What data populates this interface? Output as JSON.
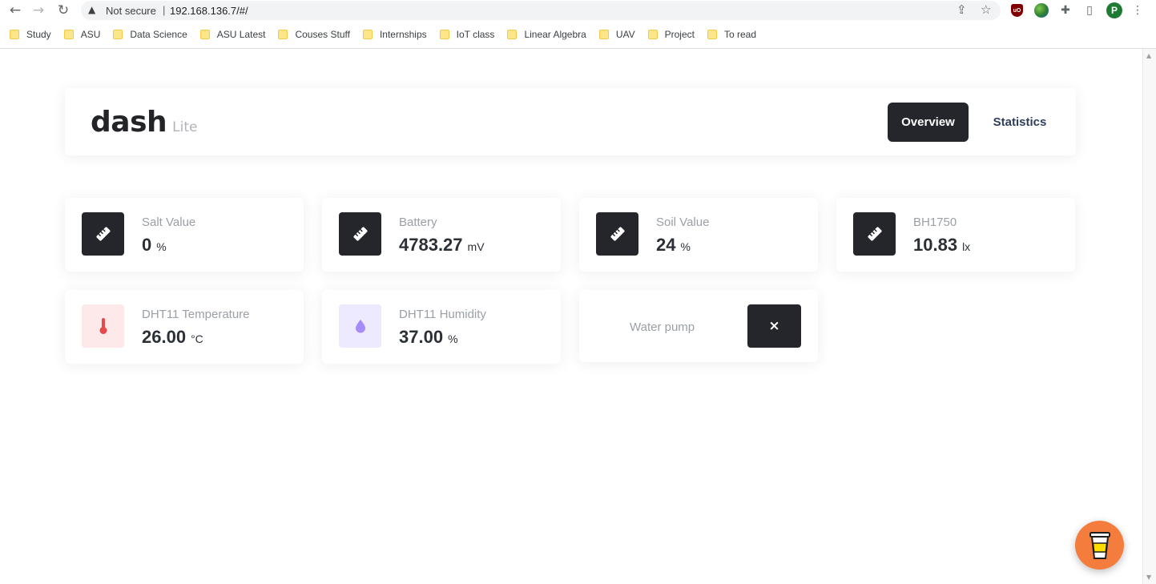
{
  "browser": {
    "security_icon": "warning-triangle-icon",
    "security_text": "Not secure",
    "separator": "|",
    "url": "192.168.136.7/#/",
    "avatar_letter": "P",
    "ublock_text": "uO",
    "bookmarks": [
      {
        "label": "Study"
      },
      {
        "label": "ASU"
      },
      {
        "label": "Data Science"
      },
      {
        "label": "ASU Latest"
      },
      {
        "label": "Couses Stuff"
      },
      {
        "label": "Internships"
      },
      {
        "label": "IoT class"
      },
      {
        "label": "Linear Algebra"
      },
      {
        "label": "UAV"
      },
      {
        "label": "Project"
      },
      {
        "label": "To read"
      }
    ]
  },
  "header": {
    "brand": "dash",
    "brand_sub": "Lite",
    "tabs": [
      {
        "label": "Overview",
        "active": true
      },
      {
        "label": "Statistics",
        "active": false
      }
    ]
  },
  "cards": [
    {
      "title": "Salt Value",
      "value": "0",
      "unit": "%",
      "icon": "ruler-icon"
    },
    {
      "title": "Battery",
      "value": "4783.27",
      "unit": "mV",
      "icon": "ruler-icon"
    },
    {
      "title": "Soil Value",
      "value": "24",
      "unit": "%",
      "icon": "ruler-icon"
    },
    {
      "title": "BH1750",
      "value": "10.83",
      "unit": "lx",
      "icon": "ruler-icon"
    },
    {
      "title": "DHT11 Temperature",
      "value": "26.00",
      "unit": "°C",
      "icon": "thermometer-icon"
    },
    {
      "title": "DHT11 Humidity",
      "value": "37.00",
      "unit": "%",
      "icon": "droplet-icon"
    }
  ],
  "water_pump": {
    "label": "Water pump",
    "toggle_symbol": "×"
  },
  "colors": {
    "dark": "#24262b",
    "accent_orange": "#f47c3c",
    "thermometer_red": "#e5484d",
    "droplet_purple": "#a78bfa"
  }
}
